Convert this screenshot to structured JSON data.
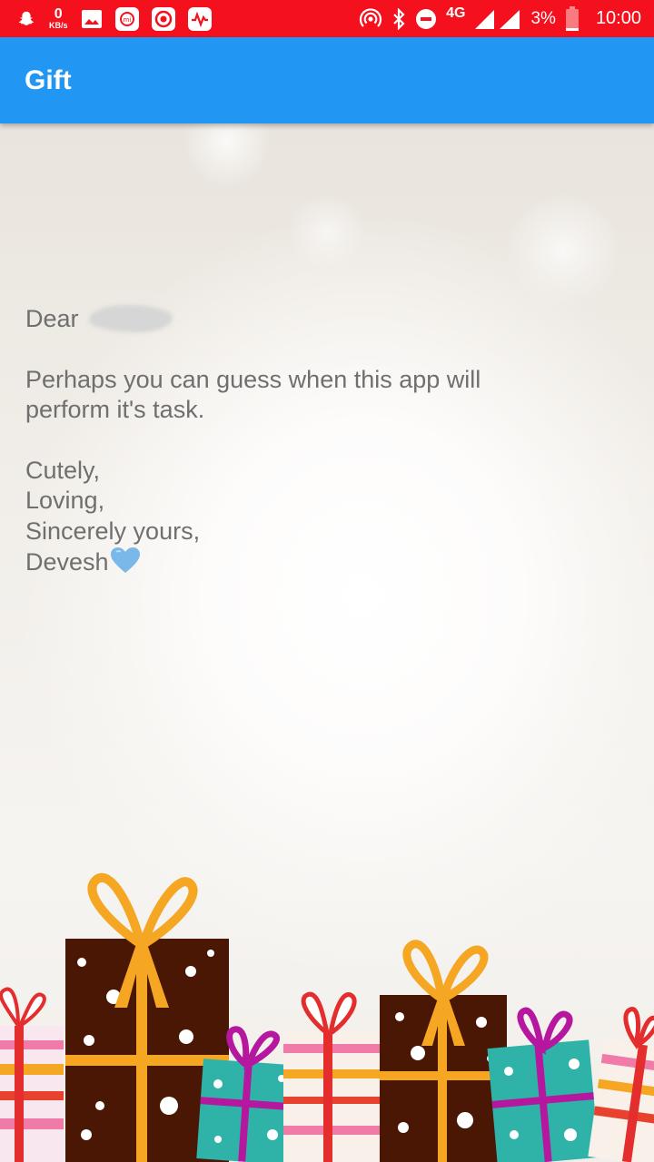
{
  "status_bar": {
    "net_speed_value": "0",
    "net_speed_unit": "KB/s",
    "network_type": "4G",
    "battery_percent": "3%",
    "time": "10:00",
    "icons": [
      "snapchat-icon",
      "gallery-icon",
      "mi-icon",
      "target-icon",
      "activity-icon",
      "hotspot-icon",
      "bluetooth-icon",
      "do-not-disturb-icon",
      "signal-icon",
      "battery-icon"
    ]
  },
  "app_bar": {
    "title": "Gift"
  },
  "letter": {
    "greeting": "Dear",
    "body_line1": "Perhaps you can guess when this app will",
    "body_line2": "perform it's task.",
    "closing1": "Cutely,",
    "closing2": "Loving,",
    "closing3": "Sincerely yours,",
    "signature": "Devesh"
  },
  "colors": {
    "status_bar": "#f4101c",
    "app_bar": "#2196f3",
    "text": "#6f6f6f",
    "heart": "#7ab8ea"
  }
}
